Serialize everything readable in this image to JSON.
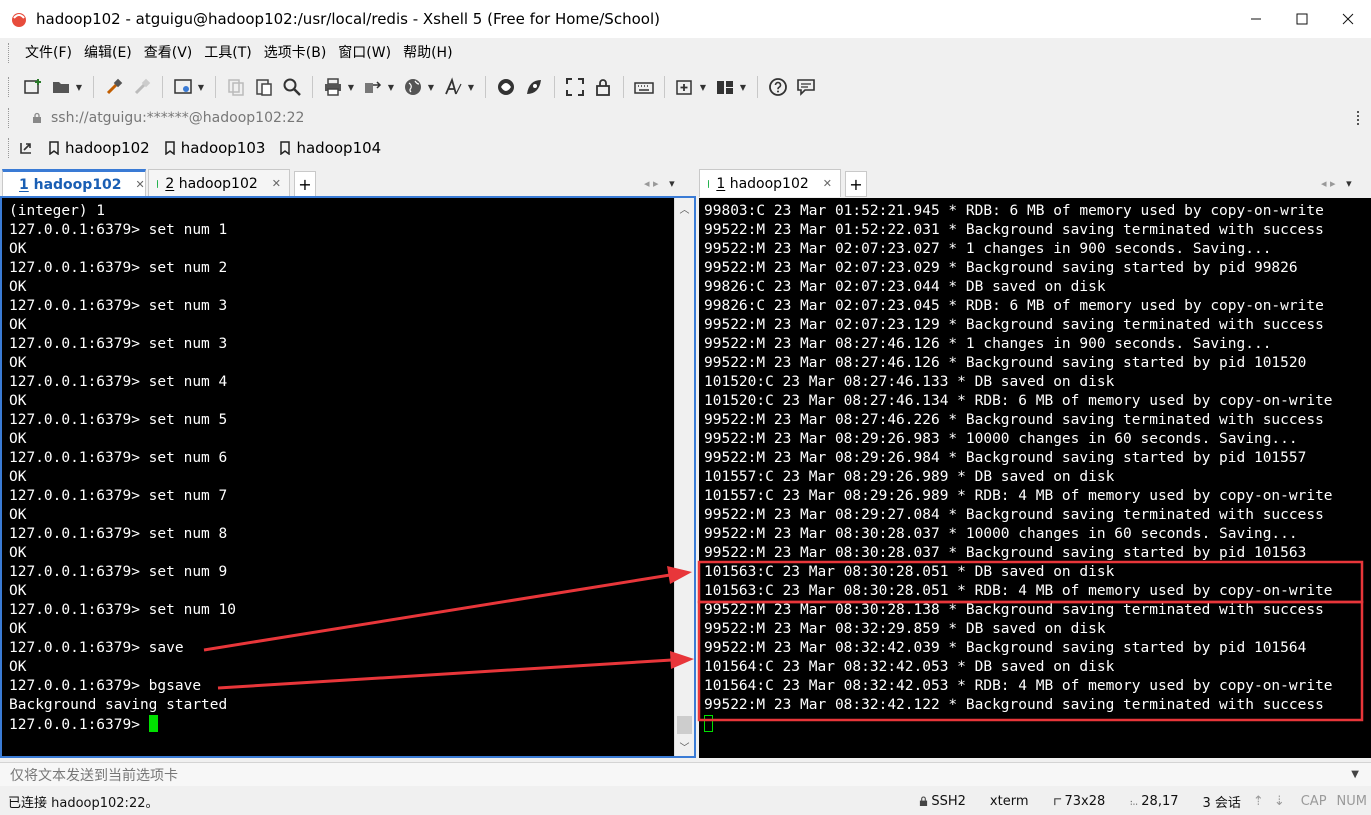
{
  "window": {
    "title": "hadoop102 - atguigu@hadoop102:/usr/local/redis - Xshell 5 (Free for Home/School)",
    "icon": "xshell-app-icon"
  },
  "menu": [
    {
      "label": "文件(F)"
    },
    {
      "label": "编辑(E)"
    },
    {
      "label": "查看(V)"
    },
    {
      "label": "工具(T)"
    },
    {
      "label": "选项卡(B)"
    },
    {
      "label": "窗口(W)"
    },
    {
      "label": "帮助(H)"
    }
  ],
  "address": {
    "value": "ssh://atguigu:******@hadoop102:22"
  },
  "links": [
    {
      "label": "hadoop102"
    },
    {
      "label": "hadoop103"
    },
    {
      "label": "hadoop104"
    }
  ],
  "left_tabs": [
    {
      "num": "1",
      "name": "hadoop102",
      "active": true
    },
    {
      "num": "2",
      "name": "hadoop102",
      "active": false
    }
  ],
  "right_tabs": [
    {
      "num": "1",
      "name": "hadoop102",
      "active": false
    }
  ],
  "left_terminal": {
    "lines": [
      "(integer) 1",
      "127.0.0.1:6379> set num 1",
      "OK",
      "127.0.0.1:6379> set num 2",
      "OK",
      "127.0.0.1:6379> set num 3",
      "OK",
      "127.0.0.1:6379> set num 3",
      "OK",
      "127.0.0.1:6379> set num 4",
      "OK",
      "127.0.0.1:6379> set num 5",
      "OK",
      "127.0.0.1:6379> set num 6",
      "OK",
      "127.0.0.1:6379> set num 7",
      "OK",
      "127.0.0.1:6379> set num 8",
      "OK",
      "127.0.0.1:6379> set num 9",
      "OK",
      "127.0.0.1:6379> set num 10",
      "OK",
      "127.0.0.1:6379> save",
      "OK",
      "127.0.0.1:6379> bgsave",
      "Background saving started"
    ],
    "prompt": "127.0.0.1:6379> "
  },
  "right_terminal": {
    "lines": [
      "99803:C 23 Mar 01:52:21.945 * RDB: 6 MB of memory used by copy-on-write",
      "99522:M 23 Mar 01:52:22.031 * Background saving terminated with success",
      "99522:M 23 Mar 02:07:23.027 * 1 changes in 900 seconds. Saving...",
      "99522:M 23 Mar 02:07:23.029 * Background saving started by pid 99826",
      "99826:C 23 Mar 02:07:23.044 * DB saved on disk",
      "99826:C 23 Mar 02:07:23.045 * RDB: 6 MB of memory used by copy-on-write",
      "99522:M 23 Mar 02:07:23.129 * Background saving terminated with success",
      "99522:M 23 Mar 08:27:46.126 * 1 changes in 900 seconds. Saving...",
      "99522:M 23 Mar 08:27:46.126 * Background saving started by pid 101520",
      "101520:C 23 Mar 08:27:46.133 * DB saved on disk",
      "101520:C 23 Mar 08:27:46.134 * RDB: 6 MB of memory used by copy-on-write",
      "99522:M 23 Mar 08:27:46.226 * Background saving terminated with success",
      "99522:M 23 Mar 08:29:26.983 * 10000 changes in 60 seconds. Saving...",
      "99522:M 23 Mar 08:29:26.984 * Background saving started by pid 101557",
      "101557:C 23 Mar 08:29:26.989 * DB saved on disk",
      "101557:C 23 Mar 08:29:26.989 * RDB: 4 MB of memory used by copy-on-write",
      "99522:M 23 Mar 08:29:27.084 * Background saving terminated with success",
      "99522:M 23 Mar 08:30:28.037 * 10000 changes in 60 seconds. Saving...",
      "99522:M 23 Mar 08:30:28.037 * Background saving started by pid 101563",
      "101563:C 23 Mar 08:30:28.051 * DB saved on disk",
      "101563:C 23 Mar 08:30:28.051 * RDB: 4 MB of memory used by copy-on-write",
      "99522:M 23 Mar 08:30:28.138 * Background saving terminated with success",
      "99522:M 23 Mar 08:32:29.859 * DB saved on disk",
      "99522:M 23 Mar 08:32:42.039 * Background saving started by pid 101564",
      "101564:C 23 Mar 08:32:42.053 * DB saved on disk",
      "101564:C 23 Mar 08:32:42.053 * RDB: 4 MB of memory used by copy-on-write",
      "99522:M 23 Mar 08:32:42.122 * Background saving terminated with success"
    ]
  },
  "sendbar": {
    "placeholder": "仅将文本发送到当前选项卡"
  },
  "status": {
    "connection": "已连接 hadoop102:22。",
    "protocol": "SSH2",
    "terminal": "xterm",
    "size": "73x28",
    "cursor": "28,17",
    "sessions": "3 会话",
    "cap": "CAP",
    "num": "NUM"
  },
  "colors": {
    "annotation": "#e8363a",
    "cursor": "#00e000",
    "active_tab_accent": "#3a7bd5",
    "tab_dot": "#22b14c"
  }
}
